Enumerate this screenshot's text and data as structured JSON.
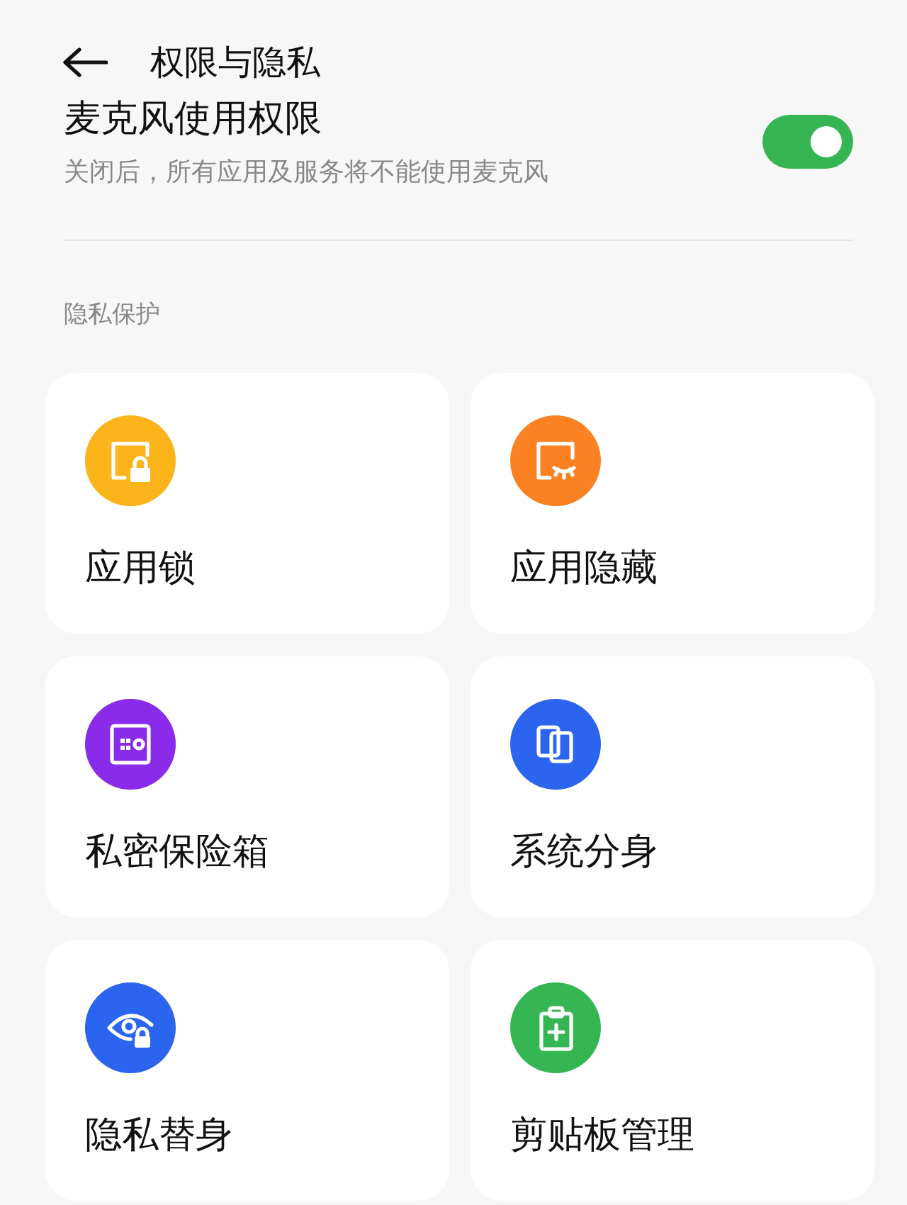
{
  "header": {
    "title": "权限与隐私"
  },
  "microphone": {
    "title": "麦克风使用权限",
    "description": "关闭后，所有应用及服务将不能使用麦克风",
    "on": true
  },
  "section": {
    "title": "隐私保护"
  },
  "cards": [
    {
      "label": "应用锁",
      "kind": "app-lock",
      "color": "#fbb419"
    },
    {
      "label": "应用隐藏",
      "kind": "app-hide",
      "color": "#fb8122"
    },
    {
      "label": "私密保险箱",
      "kind": "vault",
      "color": "#8a2be9"
    },
    {
      "label": "系统分身",
      "kind": "clone",
      "color": "#2b64ee"
    },
    {
      "label": "隐私替身",
      "kind": "eye-lock",
      "color": "#2b64ee"
    },
    {
      "label": "剪贴板管理",
      "kind": "clipboard",
      "color": "#36b653"
    }
  ]
}
